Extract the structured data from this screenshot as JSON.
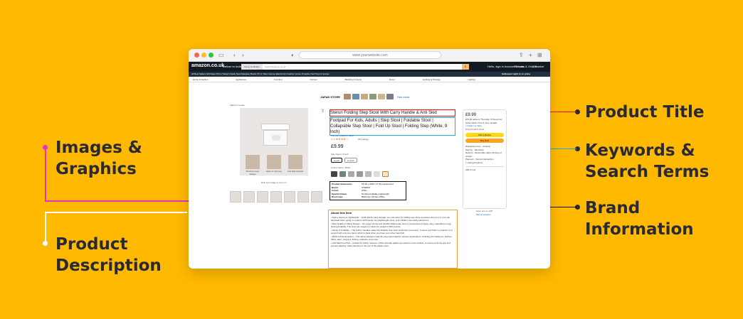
{
  "callouts": {
    "images": [
      "Images &",
      "Graphics"
    ],
    "description": [
      "Product",
      "Description"
    ],
    "title": [
      "Product Title"
    ],
    "keywords": [
      "Keywords &",
      "Search Terms"
    ],
    "brand": [
      "Brand",
      "Information"
    ]
  },
  "colors": {
    "background": "#FFB900",
    "title_marker": "#ff0000",
    "keyword_marker": "#22a8d6",
    "images_marker": "#e830c2",
    "description_marker": "#f39c3a",
    "brand_marker": "#111111"
  },
  "browser": {
    "url": "www.yourwebsite.com",
    "icons": [
      "sidebar-icon",
      "back-icon",
      "forward-icon",
      "shield-icon",
      "share-icon",
      "new-tab-icon",
      "tabs-icon"
    ]
  },
  "amazon": {
    "logo": "amazon.co.uk",
    "deliver": "Deliver to India",
    "search_category": "Home & Kitchen",
    "search_placeholder": "Search Amazon.co.uk",
    "account": "Hello, sign in Account & Lists",
    "returns": "Returns & Orders",
    "basket": "Basket",
    "nav_items": "All   Best Sellers   Gift Ideas   Prime   Today's Deals   New Releases   Books   PC & Video Games   Electronics   Fashion   Home & Garden   Sell   Toys & Games",
    "promo": "Halloween night in on prime",
    "sub_nav": [
      "Home & Garden",
      "Appliances",
      "Furniture",
      "Kitchen",
      "Bedding & Linens",
      "Décor",
      "Lighting & Storage",
      "Lighting"
    ],
    "store_banner": "JAPAN STORE",
    "see_more": "See more"
  },
  "product": {
    "back_link": "‹ Back to results",
    "title_line1": "Sterun Folding Step Stool With Carry Handle & Anti Skid",
    "title_rest": "Footpad For Kids, Adults | Step Stool | Foldable Stool | Collapsible Step Stool | Fold Up Stool | Folding Step (White, 9 Inch)",
    "store_link": "Visit the STERUN Store",
    "rating": "4.4 ★★★★☆",
    "ratings_count": "153 ratings",
    "price": "£9.99",
    "size_label": "Size Name: 9 Inch",
    "size_options": [
      "9 Inch",
      "11 Inch"
    ],
    "colour_label": "Colour Name: White",
    "feature_labels": [
      "Round corner design",
      "Easy to carrying",
      "Anti-skid footpad"
    ],
    "roll_hint": "Roll over image to zoom in"
  },
  "brand_info": [
    {
      "k": "Product dimensions",
      "v": "23.4D x 32W x 27.9H centimetres"
    },
    {
      "k": "Brand",
      "v": "STERUN"
    },
    {
      "k": "Colour",
      "v": "White"
    },
    {
      "k": "Special feature",
      "v": "Durable,Foldable,Lightweight"
    },
    {
      "k": "Room type",
      "v": "Bathroom,Kitchen,Office"
    }
  ],
  "description": {
    "heading": "About this item",
    "bullets": [
      "Space Saving & Lightweight – Folds flat for easy storage; you can store the folding step stool anywhere and put it in your car backseat when going on a picnic with friends. As a lightweight stool, your children can easily transport it.",
      "Best Quality & Safety Design – Our super strong and durable folding step stool is constructed of heavy-duty materials for long-lasting durability. The stool can support a maximum weight of 300 pounds.",
      "Handy & Foldable – The built-in handles make this foldable step stool extremely convenient. It opens and folds in a fraction of a second with only one hand, which is ideal when you have your other hand full.",
      "Multi-functional Helper – The safety features make the step stool ideal for various applications, including the bathroom, kitchen, office, lawn, campers, fishing, outdoors, and more.",
      "Anti-Skid Foot Pad – Crafted for safety reasons, rubber anti-slip pallets are placed on the surface, to ensure a strong grip and prevent slipping, while standing on the top of the plastic stool."
    ]
  },
  "buybox": {
    "price": "£9.99",
    "delivery": "£79.92 delivery Thursday, 9 November. Order within 3 hrs 9 mins. Details",
    "location": "Deliver to India",
    "stock": "Only 12 left in stock.",
    "add_to_basket": "Add to Basket",
    "buy_now": "Buy Now",
    "info_rows": [
      {
        "k": "Dispatches from",
        "v": "Amazon"
      },
      {
        "k": "Sold by",
        "v": "SinoGlow"
      },
      {
        "k": "Returns",
        "v": "Returnable within 30 days of receipt"
      },
      {
        "k": "Payment",
        "v": "Secure transaction"
      }
    ],
    "gift": "Add gift options",
    "add_list": "Add to List",
    "sell": "Have one to sell?",
    "sell_link": "Sell on Amazon"
  }
}
